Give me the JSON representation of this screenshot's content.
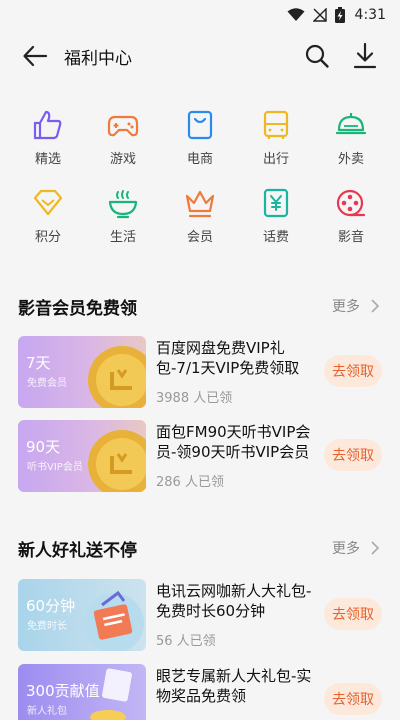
{
  "status": {
    "time": "4:31"
  },
  "header": {
    "title": "福利中心"
  },
  "colors": {
    "accent": "#e8612c",
    "claim_bg": "#fde9dc"
  },
  "grid": [
    {
      "label": "精选",
      "icon": "thumbs-up-icon",
      "color": "#7b5cf0"
    },
    {
      "label": "游戏",
      "icon": "gamepad-icon",
      "color": "#f07a3c"
    },
    {
      "label": "电商",
      "icon": "shopping-bag-icon",
      "color": "#2a8ce8"
    },
    {
      "label": "出行",
      "icon": "bus-icon",
      "color": "#f0b820"
    },
    {
      "label": "外卖",
      "icon": "food-cloche-icon",
      "color": "#19b57a"
    },
    {
      "label": "积分",
      "icon": "diamond-icon",
      "color": "#f0b820"
    },
    {
      "label": "生活",
      "icon": "bowl-icon",
      "color": "#19b57a"
    },
    {
      "label": "会员",
      "icon": "crown-icon",
      "color": "#f07a3c"
    },
    {
      "label": "话费",
      "icon": "yen-card-icon",
      "color": "#19b5a0"
    },
    {
      "label": "影音",
      "icon": "film-reel-icon",
      "color": "#e8384f"
    }
  ],
  "sections": [
    {
      "title": "影音会员免费领",
      "more": "更多",
      "cards": [
        {
          "thumb_big": "7天",
          "thumb_small": "免费会员",
          "title": "百度网盘免费VIP礼包-7/1天VIP免费领取",
          "count": "3988 人已领",
          "button": "去领取"
        },
        {
          "thumb_big": "90天",
          "thumb_small": "听书VIP会员",
          "title": "面包FM90天听书VIP会员-领90天听书VIP会员",
          "count": "286 人已领",
          "button": "去领取"
        }
      ]
    },
    {
      "title": "新人好礼送不停",
      "more": "更多",
      "cards": [
        {
          "thumb_big": "60分钟",
          "thumb_small": "免费时长",
          "title": "电讯云网咖新人大礼包-免费时长60分钟",
          "count": "56 人已领",
          "button": "去领取"
        },
        {
          "thumb_big": "300贡献值",
          "thumb_small": "新人礼包",
          "title": "眼艺专属新人大礼包-实物奖品免费领",
          "count": "",
          "button": "去领取"
        }
      ]
    }
  ]
}
